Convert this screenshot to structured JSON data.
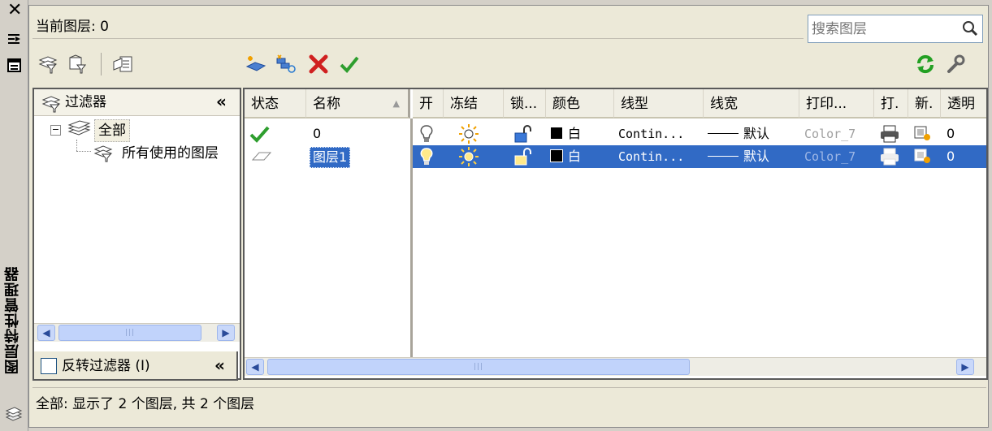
{
  "palette_title": "图层特性管理器",
  "current_layer": "当前图层: 0",
  "search": {
    "placeholder": "搜索图层"
  },
  "filters": {
    "header": "过滤器",
    "tree": [
      {
        "label": "全部",
        "expanded": true
      },
      {
        "label": "所有使用的图层"
      }
    ],
    "invert_label": "反转过滤器 (I)"
  },
  "columns": {
    "status": "状态",
    "name": "名称",
    "on": "开",
    "freeze": "冻结",
    "lock": "锁...",
    "color": "颜色",
    "linetype": "线型",
    "lineweight": "线宽",
    "plotstyle": "打印...",
    "plot": "打.",
    "newvp": "新.",
    "transparency": "透明"
  },
  "rows": [
    {
      "status": "current",
      "name": "0",
      "color": "白",
      "linetype": "Contin...",
      "lineweight": "默认",
      "plotstyle": "Color_7",
      "transparency": "0",
      "selected": false
    },
    {
      "status": "layer",
      "name": "图层1",
      "color": "白",
      "linetype": "Contin...",
      "lineweight": "默认",
      "plotstyle": "Color_7",
      "transparency": "0",
      "selected": true
    }
  ],
  "status_text": "全部: 显示了 2 个图层, 共 2 个图层",
  "colors": {
    "selection": "#316ac5",
    "check": "#2e9e2e",
    "delete": "#d02020",
    "refresh": "#23a023"
  }
}
